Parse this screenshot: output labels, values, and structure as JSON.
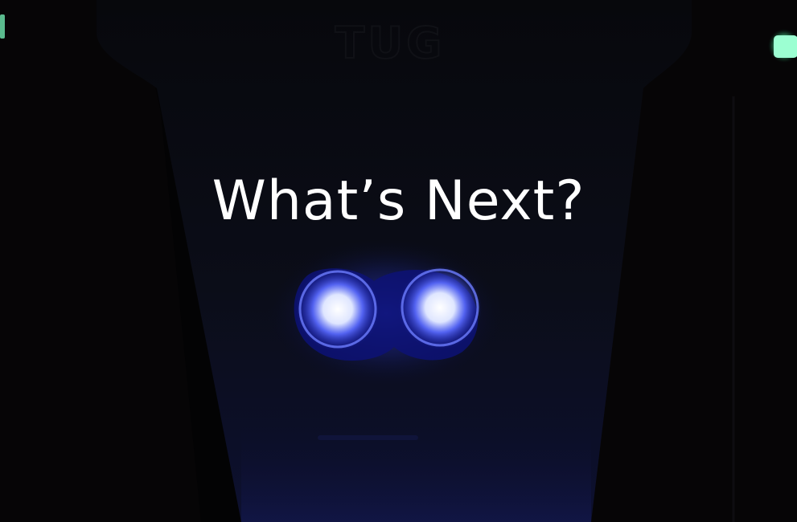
{
  "headline": "What’s Next?",
  "logo_text": "TUG",
  "colors": {
    "background": "#020204",
    "headlight_glow": "#2a3cff",
    "headlight_core": "#ffffff",
    "indicator_green": "#7cffc0"
  },
  "icons": [
    "headlight-left-icon",
    "headlight-right-icon",
    "green-indicator-icon"
  ]
}
